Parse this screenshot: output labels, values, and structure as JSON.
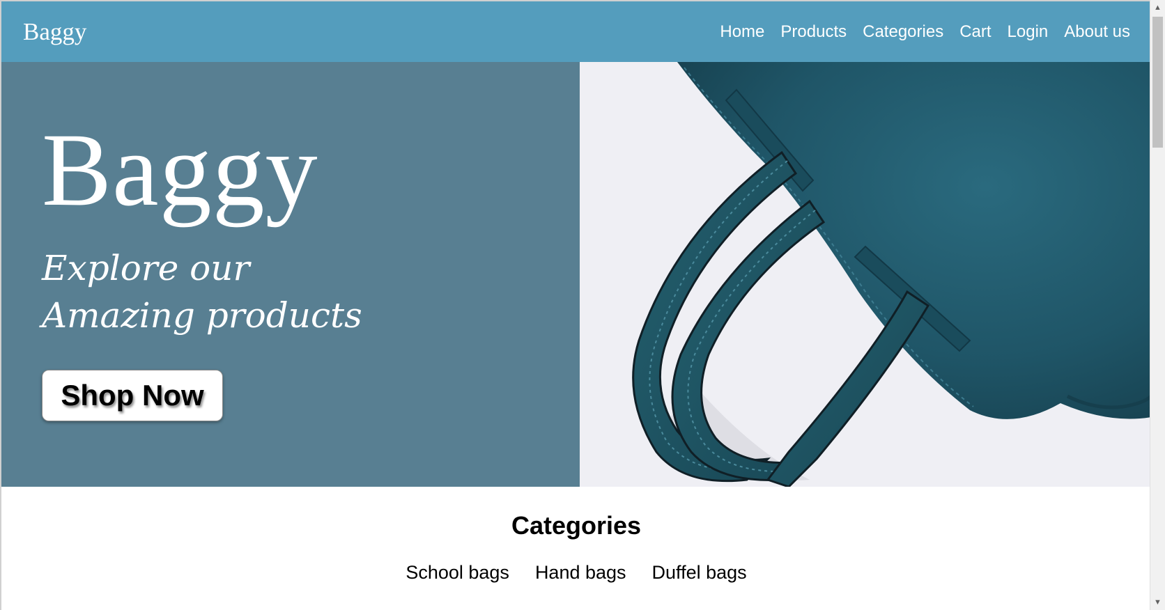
{
  "navbar": {
    "brand": "Baggy",
    "links": [
      "Home",
      "Products",
      "Categories",
      "Cart",
      "Login",
      "About us"
    ],
    "background": "#549dbd"
  },
  "hero": {
    "title": "Baggy",
    "subtitle": "Explore our Amazing products",
    "button_label": "Shop Now",
    "left_background": "#587f92",
    "image_icon": "teal-suede-handbag-image"
  },
  "categories": {
    "heading": "Categories",
    "items": [
      "School bags",
      "Hand bags",
      "Duffel bags"
    ]
  },
  "colors": {
    "bag": "#1f5567",
    "image_background": "#efeff4"
  }
}
